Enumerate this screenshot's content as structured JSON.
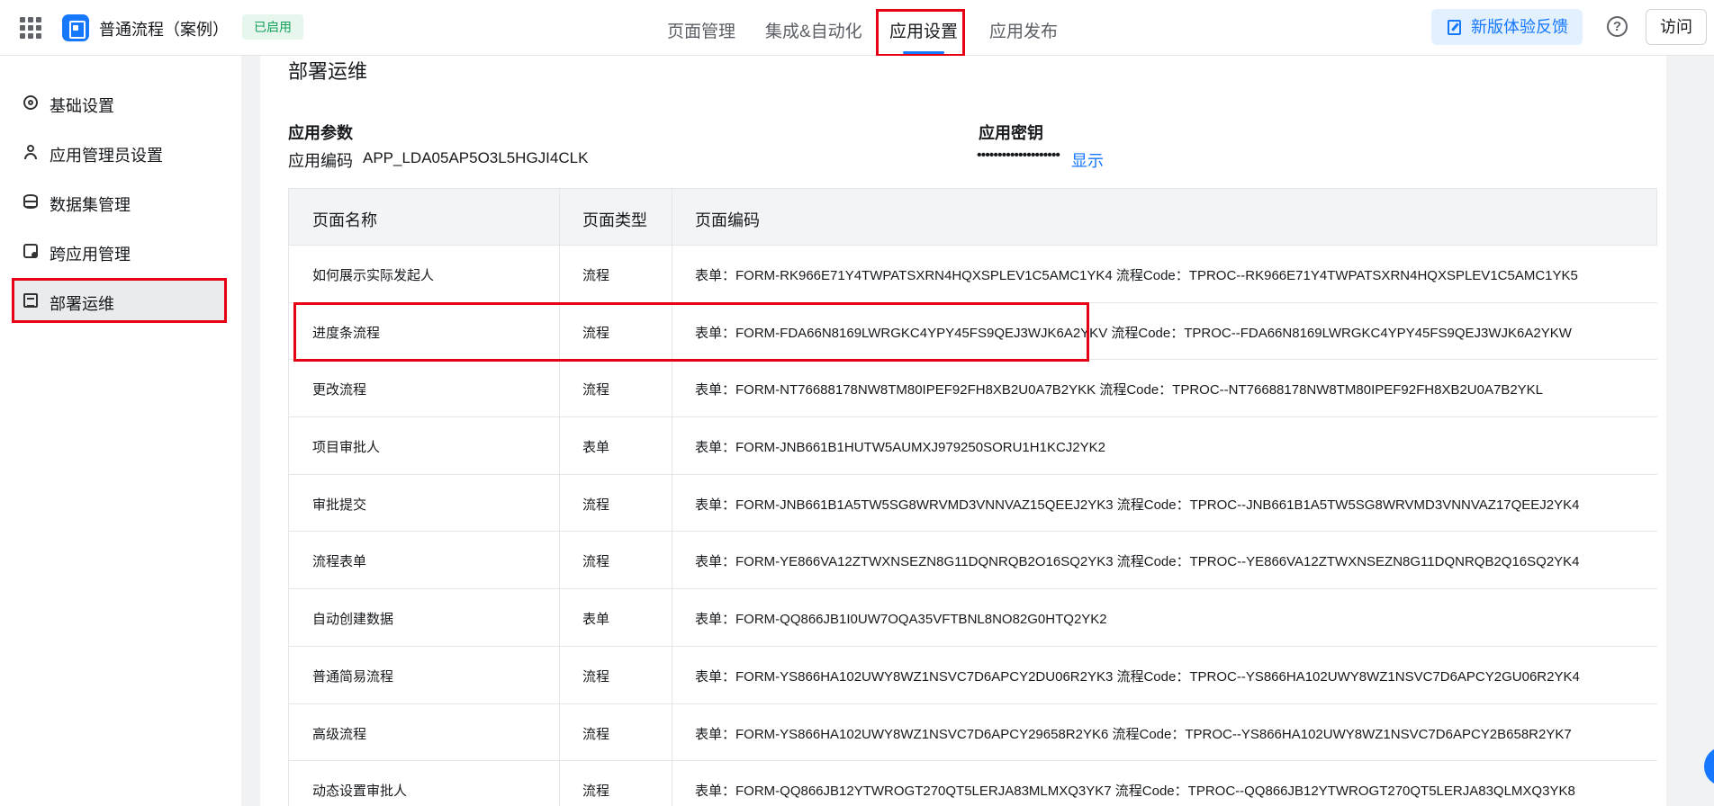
{
  "header": {
    "app_title": "普通流程（案例）",
    "status": "已启用",
    "tabs": [
      "页面管理",
      "集成&自动化",
      "应用设置",
      "应用发布"
    ],
    "active_tab": "应用设置",
    "feedback_label": "新版体验反馈",
    "help_symbol": "?",
    "visit_label": "访问"
  },
  "sidebar": {
    "items": [
      {
        "label": "基础设置",
        "icon": "gear-icon"
      },
      {
        "label": "应用管理员设置",
        "icon": "user-icon"
      },
      {
        "label": "数据集管理",
        "icon": "database-icon"
      },
      {
        "label": "跨应用管理",
        "icon": "cross-app-icon"
      },
      {
        "label": "部署运维",
        "icon": "deploy-icon"
      }
    ],
    "active_item": "部署运维"
  },
  "main": {
    "section_title": "部署运维",
    "params_label": "应用参数",
    "app_code_label": "应用编码",
    "app_code_value": "APP_LDA05AP5O3L5HGJI4CLK",
    "secret_label": "应用密钥",
    "secret_mask": "••••••••••••••••••••",
    "show_label": "显示"
  },
  "table": {
    "headers": [
      "页面名称",
      "页面类型",
      "页面编码"
    ],
    "rows": [
      {
        "name": "如何展示实际发起人",
        "type": "流程",
        "code": "表单：FORM-RK966E71Y4TWPATSXRN4HQXSPLEV1C5AMC1YK4   流程Code：TPROC--RK966E71Y4TWPATSXRN4HQXSPLEV1C5AMC1YK5"
      },
      {
        "name": "进度条流程",
        "type": "流程",
        "code": "表单：FORM-FDA66N8169LWRGKC4YPY45FS9QEJ3WJK6A2YKV   流程Code：TPROC--FDA66N8169LWRGKC4YPY45FS9QEJ3WJK6A2YKW"
      },
      {
        "name": "更改流程",
        "type": "流程",
        "code": "表单：FORM-NT76688178NW8TM80IPEF92FH8XB2U0A7B2YKK   流程Code：TPROC--NT76688178NW8TM80IPEF92FH8XB2U0A7B2YKL"
      },
      {
        "name": "项目审批人",
        "type": "表单",
        "code": "表单：FORM-JNB661B1HUTW5AUMXJ979250SORU1H1KCJ2YK2"
      },
      {
        "name": "审批提交",
        "type": "流程",
        "code": "表单：FORM-JNB661B1A5TW5SG8WRVMD3VNNVAZ15QEEJ2YK3   流程Code：TPROC--JNB661B1A5TW5SG8WRVMD3VNNVAZ17QEEJ2YK4"
      },
      {
        "name": "流程表单",
        "type": "流程",
        "code": "表单：FORM-YE866VA12ZTWXNSEZN8G11DQNRQB2O16SQ2YK3   流程Code：TPROC--YE866VA12ZTWXNSEZN8G11DQNRQB2Q16SQ2YK4"
      },
      {
        "name": "自动创建数据",
        "type": "表单",
        "code": "表单：FORM-QQ866JB1I0UW7OQA35VFTBNL8NO82G0HTQ2YK2"
      },
      {
        "name": "普通简易流程",
        "type": "流程",
        "code": "表单：FORM-YS866HA102UWY8WZ1NSVC7D6APCY2DU06R2YK3   流程Code：TPROC--YS866HA102UWY8WZ1NSVC7D6APCY2GU06R2YK4"
      },
      {
        "name": "高级流程",
        "type": "流程",
        "code": "表单：FORM-YS866HA102UWY8WZ1NSVC7D6APCY29658R2YK6   流程Code：TPROC--YS866HA102UWY8WZ1NSVC7D6APCY2B658R2YK7"
      },
      {
        "name": "动态设置审批人",
        "type": "流程",
        "code": "表单：FORM-QQ866JB12YTWROGT270QT5LERJA83MLMXQ3YK7   流程Code：TPROC--QQ866JB12YTWROGT270QT5LERJA83QLMXQ3YK8"
      }
    ]
  },
  "colors": {
    "accent": "#1677ff",
    "highlight": "#e60012",
    "status_green": "#11a15b"
  }
}
